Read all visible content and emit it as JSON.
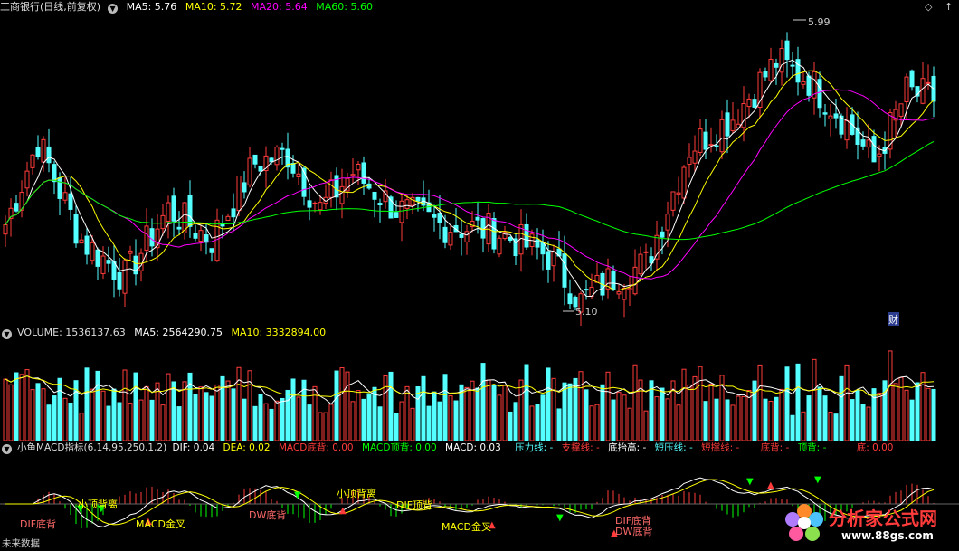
{
  "price_panel": {
    "stock_name": "工商银行(日线,前复权)",
    "ma5": "MA5: 5.76",
    "ma10": "MA10: 5.72",
    "ma20": "MA20: 5.64",
    "ma60": "MA60: 5.60",
    "high_label": "5.99",
    "low_label": "5.10",
    "finance_mark": "财",
    "controls": [
      "◇",
      "↑"
    ]
  },
  "volume_panel": {
    "volume": "VOLUME: 1536137.63",
    "ma5": "MA5: 2564290.75",
    "ma10": "MA10: 3332894.00"
  },
  "macd_panel": {
    "indicator": "小鱼MACD指标(6,14,95,250,1,2)",
    "dif": "DIF: 0.04",
    "dea": "DEA: 0.02",
    "macd_bottom_div": "MACD底背: 0.00",
    "macd_top_div": "MACD顶背: 0.00",
    "macd": "MACD: 0.03",
    "pressure": "压力线: -",
    "support": "支撑线: -",
    "bottom_rise": "底抬高: -",
    "short_pressure": "短压线: -",
    "short_support": "短撑线: -",
    "bottom_back": "底背: -",
    "top_back": "顶背: -",
    "bottom": "底: 0.00",
    "labels": [
      "DIF底背",
      "小顶背离",
      "MACD金叉",
      "DW底背",
      "小顶背离",
      "DIF顶背",
      "MACD金叉",
      "DIF底背",
      "DW底背"
    ],
    "future_label": "未来数据",
    "watermark_text": "分析家公式网",
    "watermark_url": "www.88gs.com"
  },
  "colors": {
    "up": "#ff3b3b",
    "down": "#54ffff",
    "ma5": "#ffffff",
    "ma10": "#ffff00",
    "ma20": "#ff00ff",
    "ma60": "#00ff00"
  }
}
